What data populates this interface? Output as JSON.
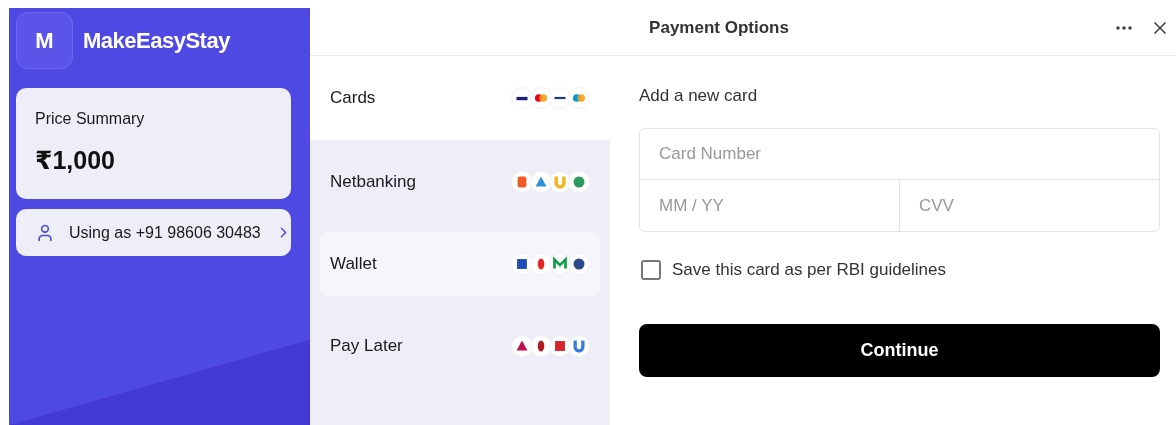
{
  "brand": {
    "initial": "M",
    "name": "MakeEasyStay"
  },
  "price_summary": {
    "label": "Price Summary",
    "amount": "₹1,000"
  },
  "account": {
    "label": "Using as +91 98606 30483"
  },
  "header": {
    "title": "Payment Options"
  },
  "methods": [
    {
      "label": "Cards",
      "selected": true,
      "highlighted": false
    },
    {
      "label": "Netbanking",
      "selected": false,
      "highlighted": false
    },
    {
      "label": "Wallet",
      "selected": false,
      "highlighted": true
    },
    {
      "label": "Pay Later",
      "selected": false,
      "highlighted": false
    }
  ],
  "card_form": {
    "heading": "Add a new card",
    "number": {
      "placeholder": "Card Number"
    },
    "expiry": {
      "placeholder": "MM / YY"
    },
    "cvv": {
      "placeholder": "CVV"
    },
    "save": {
      "label": "Save this card as per RBI guidelines",
      "checked": false
    },
    "submit": "Continue"
  }
}
